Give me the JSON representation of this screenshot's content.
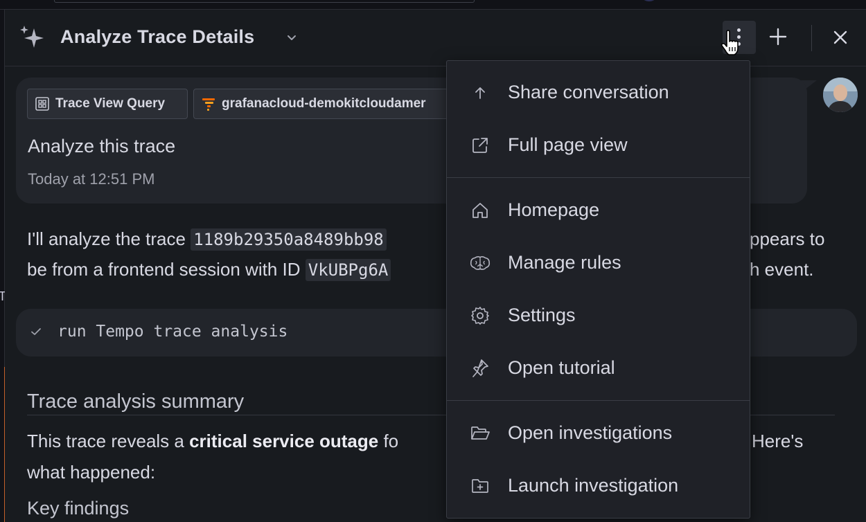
{
  "panel": {
    "title": "Analyze Trace Details"
  },
  "bubble": {
    "chips": [
      {
        "label": "Trace View Query",
        "icon": "grid-icon"
      },
      {
        "label": "grafanacloud-demokitcloudamer",
        "icon": "tempo-icon"
      }
    ],
    "message": "Analyze this trace",
    "timestamp": "Today at 12:51 PM"
  },
  "response": {
    "line1_start": "I'll analyze the trace ",
    "trace_id": "1189b29350a8489bb98",
    "line1_end": "ppears to",
    "line2_start": "be from a frontend session with ID ",
    "session_id": "VkUBPg6A",
    "line2_end": "h event."
  },
  "tool_call": {
    "label": "run Tempo trace analysis"
  },
  "summary": {
    "heading": "Trace analysis summary",
    "p1_start": "This trace reveals a ",
    "p1_bold": "critical service outage",
    "p1_cut": " fo",
    "p1_end": "Here's",
    "p2": "what happened:",
    "subheading": "Key findings"
  },
  "menu": {
    "items": [
      {
        "label": "Share conversation",
        "icon": "arrow-up-icon"
      },
      {
        "label": "Full page view",
        "icon": "external-link-icon"
      },
      {
        "label": "Homepage",
        "icon": "home-icon"
      },
      {
        "label": "Manage rules",
        "icon": "brain-icon"
      },
      {
        "label": "Settings",
        "icon": "gear-icon"
      },
      {
        "label": "Open tutorial",
        "icon": "pin-icon"
      },
      {
        "label": "Open investigations",
        "icon": "folder-open-icon"
      },
      {
        "label": "Launch investigation",
        "icon": "folder-plus-icon"
      }
    ]
  },
  "colors": {
    "background": "#181b1f",
    "bubble": "#22252b",
    "accent_orange": "#c4602a"
  }
}
